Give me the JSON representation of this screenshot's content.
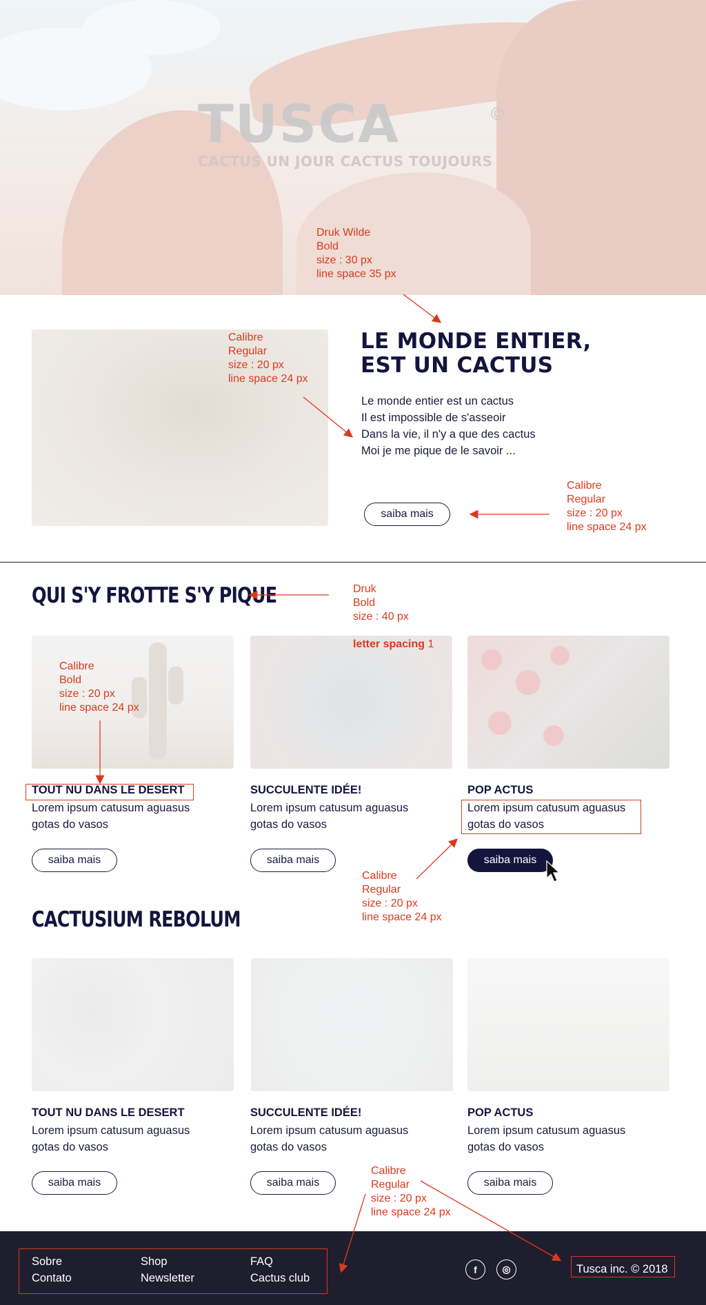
{
  "hero": {
    "logo": "TUSCA",
    "copyright_mark": "©",
    "tagline": "CACTUS UN JOUR CACTUS TOUJOURS"
  },
  "section1": {
    "title_line1": "LE MONDE ENTIER,",
    "title_line2": "EST UN CACTUS",
    "body": [
      "Le monde entier est un cactus",
      "Il est impossible de s'asseoir",
      "Dans la vie, il n'y a que des cactus",
      "Moi je me pique de le savoir ..."
    ],
    "button": "saiba mais"
  },
  "section2": {
    "title": "QUI S'Y FROTTE S'Y PIQUE",
    "cards": [
      {
        "title": "TOUT NU DANS LE DESERT",
        "desc": "Lorem ipsum catusum aguasus gotas do vasos",
        "button": "saiba mais"
      },
      {
        "title": "SUCCULENTE IDÉE!",
        "desc": "Lorem ipsum catusum aguasus gotas do vasos",
        "button": "saiba mais"
      },
      {
        "title": "POP ACTUS",
        "desc": "Lorem ipsum catusum aguasus gotas do vasos",
        "button": "saiba mais"
      }
    ]
  },
  "section3": {
    "title": "CACTUSIUM REBOLUM",
    "cards": [
      {
        "title": "TOUT NU DANS LE DESERT",
        "desc": "Lorem ipsum catusum aguasus gotas do vasos",
        "button": "saiba mais"
      },
      {
        "title": "SUCCULENTE IDÉE!",
        "desc": "Lorem ipsum catusum aguasus gotas do vasos",
        "button": "saiba mais"
      },
      {
        "title": "POP ACTUS",
        "desc": "Lorem ipsum catusum aguasus gotas do vasos",
        "button": "saiba mais"
      }
    ]
  },
  "annotations": {
    "hero_font": "Druk Wilde\nBold\nsize : 30 px\nline space 35 px",
    "s1_body_font": "Calibre\nRegular\nsize : 20 px\nline space 24 px",
    "s1_button_font": "Calibre\nRegular\nsize : 20 px\nline space 24 px",
    "s2_title_font": "Druk\nBold\nsize : 40 px",
    "s2_title_spacing_label": "letter spacing",
    "s2_title_spacing_value": " 1",
    "card_title_font": "Calibre\nBold\nsize : 20 px\nline space 24 px",
    "card_desc_font": "Calibre\nRegular\nsize : 20 px\nline space 24 px",
    "footer_font": "Calibre\nRegular\nsize : 20 px\nline space 24 px"
  },
  "footer": {
    "links": [
      "Sobre",
      "Contato",
      "Shop",
      "Newsletter",
      "FAQ",
      "Cactus club"
    ],
    "social": [
      {
        "icon": "facebook-icon",
        "glyph": "f"
      },
      {
        "icon": "instagram-icon",
        "glyph": "◎"
      }
    ],
    "copyright": "Tusca inc. © 2018"
  },
  "colors": {
    "navy": "#15143d",
    "annotation_red": "#d93a1e",
    "footer_bg": "#1f1e2e"
  }
}
